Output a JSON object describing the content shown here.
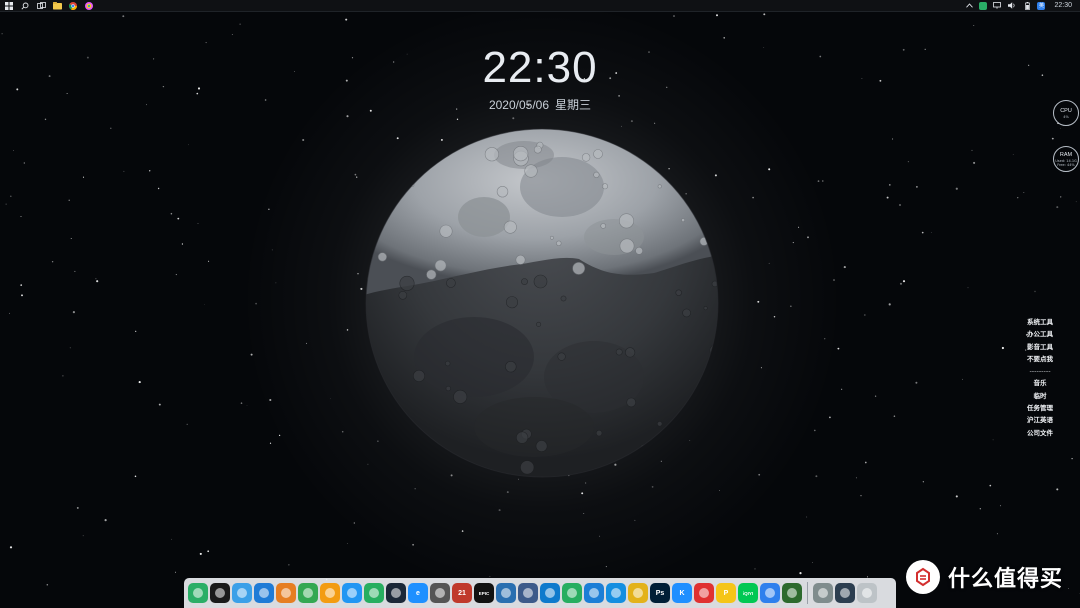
{
  "taskbar": {
    "icons": [
      "windows-start-icon",
      "search-icon",
      "task-view-icon",
      "file-explorer-icon",
      "chrome-icon",
      "colorful-app-icon"
    ],
    "tray_icons": [
      "chevron-up-icon",
      "wechat-tray-icon",
      "network-icon",
      "volume-icon",
      "battery-icon",
      "input-method-icon"
    ],
    "input_method": "英",
    "time": "22:30"
  },
  "clock": {
    "time": "22:30",
    "date": "2020/05/06",
    "weekday": "星期三"
  },
  "monitor": {
    "cpu_label": "CPU",
    "cpu_value": "4%",
    "ram_label": "RAM",
    "ram_used": "Used: 14.1G",
    "ram_free": "Free: 44%"
  },
  "quick_menu": {
    "items_top": [
      "系统工具",
      "办公工具",
      "影音工具",
      "不要点我"
    ],
    "separator": "---------",
    "items_bottom": [
      "音乐",
      "临时",
      "任务管理",
      "沪江英语",
      "公司文件"
    ]
  },
  "dock": {
    "apps": [
      {
        "name": "wechat-icon",
        "color": "#2aae67",
        "label": ""
      },
      {
        "name": "qq-icon",
        "color": "#1a1a1a",
        "label": ""
      },
      {
        "name": "tencent-app-icon",
        "color": "#3aa0e8",
        "label": ""
      },
      {
        "name": "edge-icon",
        "color": "#1f7bd6",
        "label": ""
      },
      {
        "name": "chrome-canary-icon",
        "color": "#e67e22",
        "label": ""
      },
      {
        "name": "chrome-icon",
        "color": "#34a853",
        "label": ""
      },
      {
        "name": "browser-orange-icon",
        "color": "#f39c12",
        "label": ""
      },
      {
        "name": "bilibili-icon",
        "color": "#2196f3",
        "label": ""
      },
      {
        "name": "360-browser-icon",
        "color": "#27ae60",
        "label": ""
      },
      {
        "name": "steam-icon",
        "color": "#1b2838",
        "label": ""
      },
      {
        "name": "ie-icon",
        "color": "#1e90ff",
        "label": "e"
      },
      {
        "name": "video-reel-icon",
        "color": "#555555",
        "label": ""
      },
      {
        "name": "calendar-icon",
        "color": "#c0392b",
        "label": "21"
      },
      {
        "name": "epic-games-icon",
        "color": "#111111",
        "label": "EPIC"
      },
      {
        "name": "remote-desktop-icon",
        "color": "#2a6fb0",
        "label": ""
      },
      {
        "name": "disk-tool-icon",
        "color": "#3c5a8a",
        "label": ""
      },
      {
        "name": "vscode-icon",
        "color": "#0e7acc",
        "label": ""
      },
      {
        "name": "image-viewer-icon",
        "color": "#27ae60",
        "label": ""
      },
      {
        "name": "feishu-icon",
        "color": "#1c7ed6",
        "label": ""
      },
      {
        "name": "transfer-icon",
        "color": "#148ee0",
        "label": ""
      },
      {
        "name": "tiles-icon",
        "color": "#e3b21a",
        "label": ""
      },
      {
        "name": "photoshop-icon",
        "color": "#001e36",
        "label": "Ps"
      },
      {
        "name": "kugou-icon",
        "color": "#1f8fff",
        "label": "K"
      },
      {
        "name": "netease-music-icon",
        "color": "#e03131",
        "label": ""
      },
      {
        "name": "potplayer-icon",
        "color": "#f5c518",
        "label": "P"
      },
      {
        "name": "iqiyi-icon",
        "color": "#00c853",
        "label": "iQIYI"
      },
      {
        "name": "baidu-netdisk-icon",
        "color": "#2f80ed",
        "label": ""
      },
      {
        "name": "spy-app-icon",
        "color": "#2d6a2d",
        "label": ""
      }
    ],
    "system": [
      {
        "name": "settings-gears-icon",
        "color": "#7f8c8d",
        "label": ""
      },
      {
        "name": "this-pc-icon",
        "color": "#2c3e50",
        "label": ""
      },
      {
        "name": "recycle-bin-icon",
        "color": "#bdc3c7",
        "label": ""
      }
    ]
  },
  "watermark": {
    "badge": "值",
    "text": "什么值得买"
  }
}
